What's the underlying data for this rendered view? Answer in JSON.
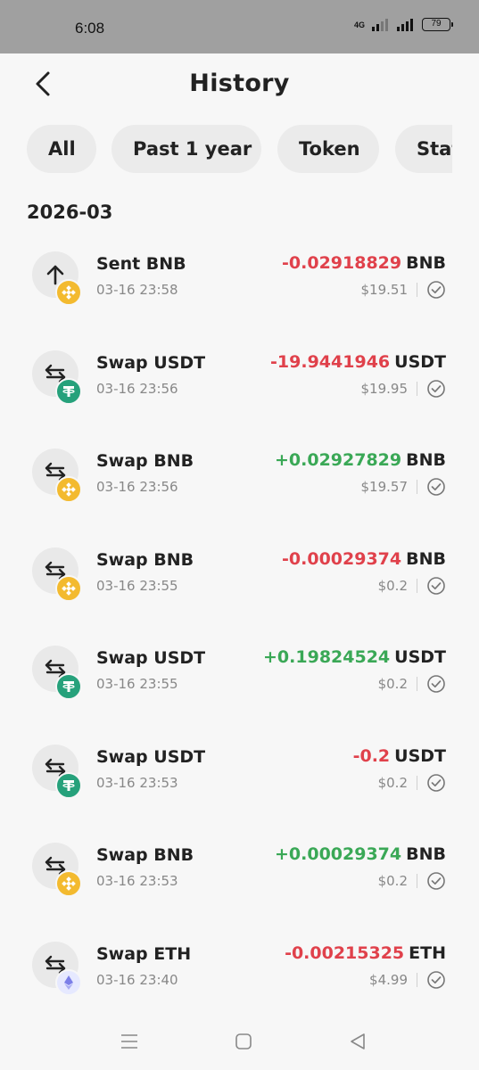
{
  "status_bar": {
    "time": "6:08",
    "network": "4G",
    "battery": "79"
  },
  "header": {
    "title": "History"
  },
  "filters": [
    {
      "label": "All"
    },
    {
      "label": "Past 1 year"
    },
    {
      "label": "Token"
    },
    {
      "label": "Status"
    }
  ],
  "month": "2026-03",
  "transactions": [
    {
      "title": "Sent BNB",
      "time": "03-16 23:58",
      "amount": "-0.02918829",
      "symbol": "BNB",
      "usd": "$19.51",
      "type": "sent",
      "token": "bnb",
      "sign": "negative"
    },
    {
      "title": "Swap USDT",
      "time": "03-16 23:56",
      "amount": "-19.9441946",
      "symbol": "USDT",
      "usd": "$19.95",
      "type": "swap",
      "token": "usdt",
      "sign": "negative"
    },
    {
      "title": "Swap BNB",
      "time": "03-16 23:56",
      "amount": "+0.02927829",
      "symbol": "BNB",
      "usd": "$19.57",
      "type": "swap",
      "token": "bnb",
      "sign": "positive"
    },
    {
      "title": "Swap BNB",
      "time": "03-16 23:55",
      "amount": "-0.00029374",
      "symbol": "BNB",
      "usd": "$0.2",
      "type": "swap",
      "token": "bnb",
      "sign": "negative"
    },
    {
      "title": "Swap USDT",
      "time": "03-16 23:55",
      "amount": "+0.19824524",
      "symbol": "USDT",
      "usd": "$0.2",
      "type": "swap",
      "token": "usdt",
      "sign": "positive"
    },
    {
      "title": "Swap USDT",
      "time": "03-16 23:53",
      "amount": "-0.2",
      "symbol": "USDT",
      "usd": "$0.2",
      "type": "swap",
      "token": "usdt",
      "sign": "negative"
    },
    {
      "title": "Swap BNB",
      "time": "03-16 23:53",
      "amount": "+0.00029374",
      "symbol": "BNB",
      "usd": "$0.2",
      "type": "swap",
      "token": "bnb",
      "sign": "positive"
    },
    {
      "title": "Swap ETH",
      "time": "03-16 23:40",
      "amount": "-0.00215325",
      "symbol": "ETH",
      "usd": "$4.99",
      "type": "swap",
      "token": "eth",
      "sign": "negative"
    }
  ],
  "colors": {
    "negative": "#e0414b",
    "positive": "#3aa856",
    "bnb": "#f3ba2f",
    "usdt": "#26a17b"
  },
  "icons": {
    "back": "chevron-left-icon",
    "sent": "arrow-up-icon",
    "swap": "swap-arrows-icon",
    "status": "check-circle-icon",
    "nav": [
      "menu-icon",
      "home-square-icon",
      "back-triangle-icon"
    ]
  }
}
